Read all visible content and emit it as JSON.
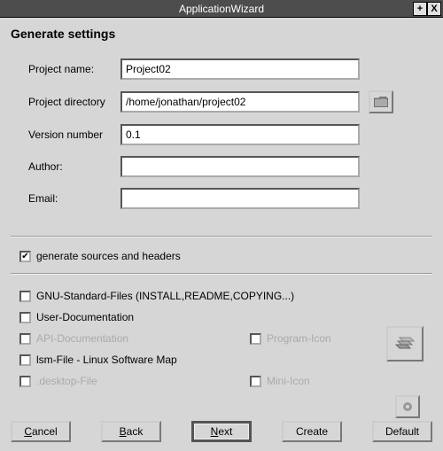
{
  "window": {
    "title": "ApplicationWizard",
    "maximize": "+",
    "close": "X"
  },
  "heading": "Generate settings",
  "fields": {
    "project_name": {
      "label": "Project name:",
      "value": "Project02"
    },
    "project_dir": {
      "label": "Project directory",
      "value": "/home/jonathan/project02"
    },
    "version": {
      "label": "Version number",
      "value": "0.1"
    },
    "author": {
      "label": "Author:",
      "value": ""
    },
    "email": {
      "label": "Email:",
      "value": ""
    }
  },
  "generate_chk": {
    "checked": true,
    "label": "generate sources and headers",
    "mark": "✔"
  },
  "options": {
    "gnu": {
      "checked": false,
      "label": "GNU-Standard-Files (INSTALL,README,COPYING...)"
    },
    "userdoc": {
      "checked": false,
      "label": "User-Documentation"
    },
    "apidoc": {
      "checked": false,
      "label": "API-Documentation"
    },
    "progicon": {
      "checked": false,
      "label": "Program-Icon"
    },
    "lsm": {
      "checked": false,
      "label": "lsm-File - Linux Software Map"
    },
    "desktop": {
      "checked": false,
      "label": ".desktop-File"
    },
    "miniicon": {
      "checked": false,
      "label": "Mini-Icon"
    }
  },
  "buttons": {
    "cancel": "Cancel",
    "back": "Back",
    "next": "Next",
    "create": "Create",
    "default": "Default"
  }
}
